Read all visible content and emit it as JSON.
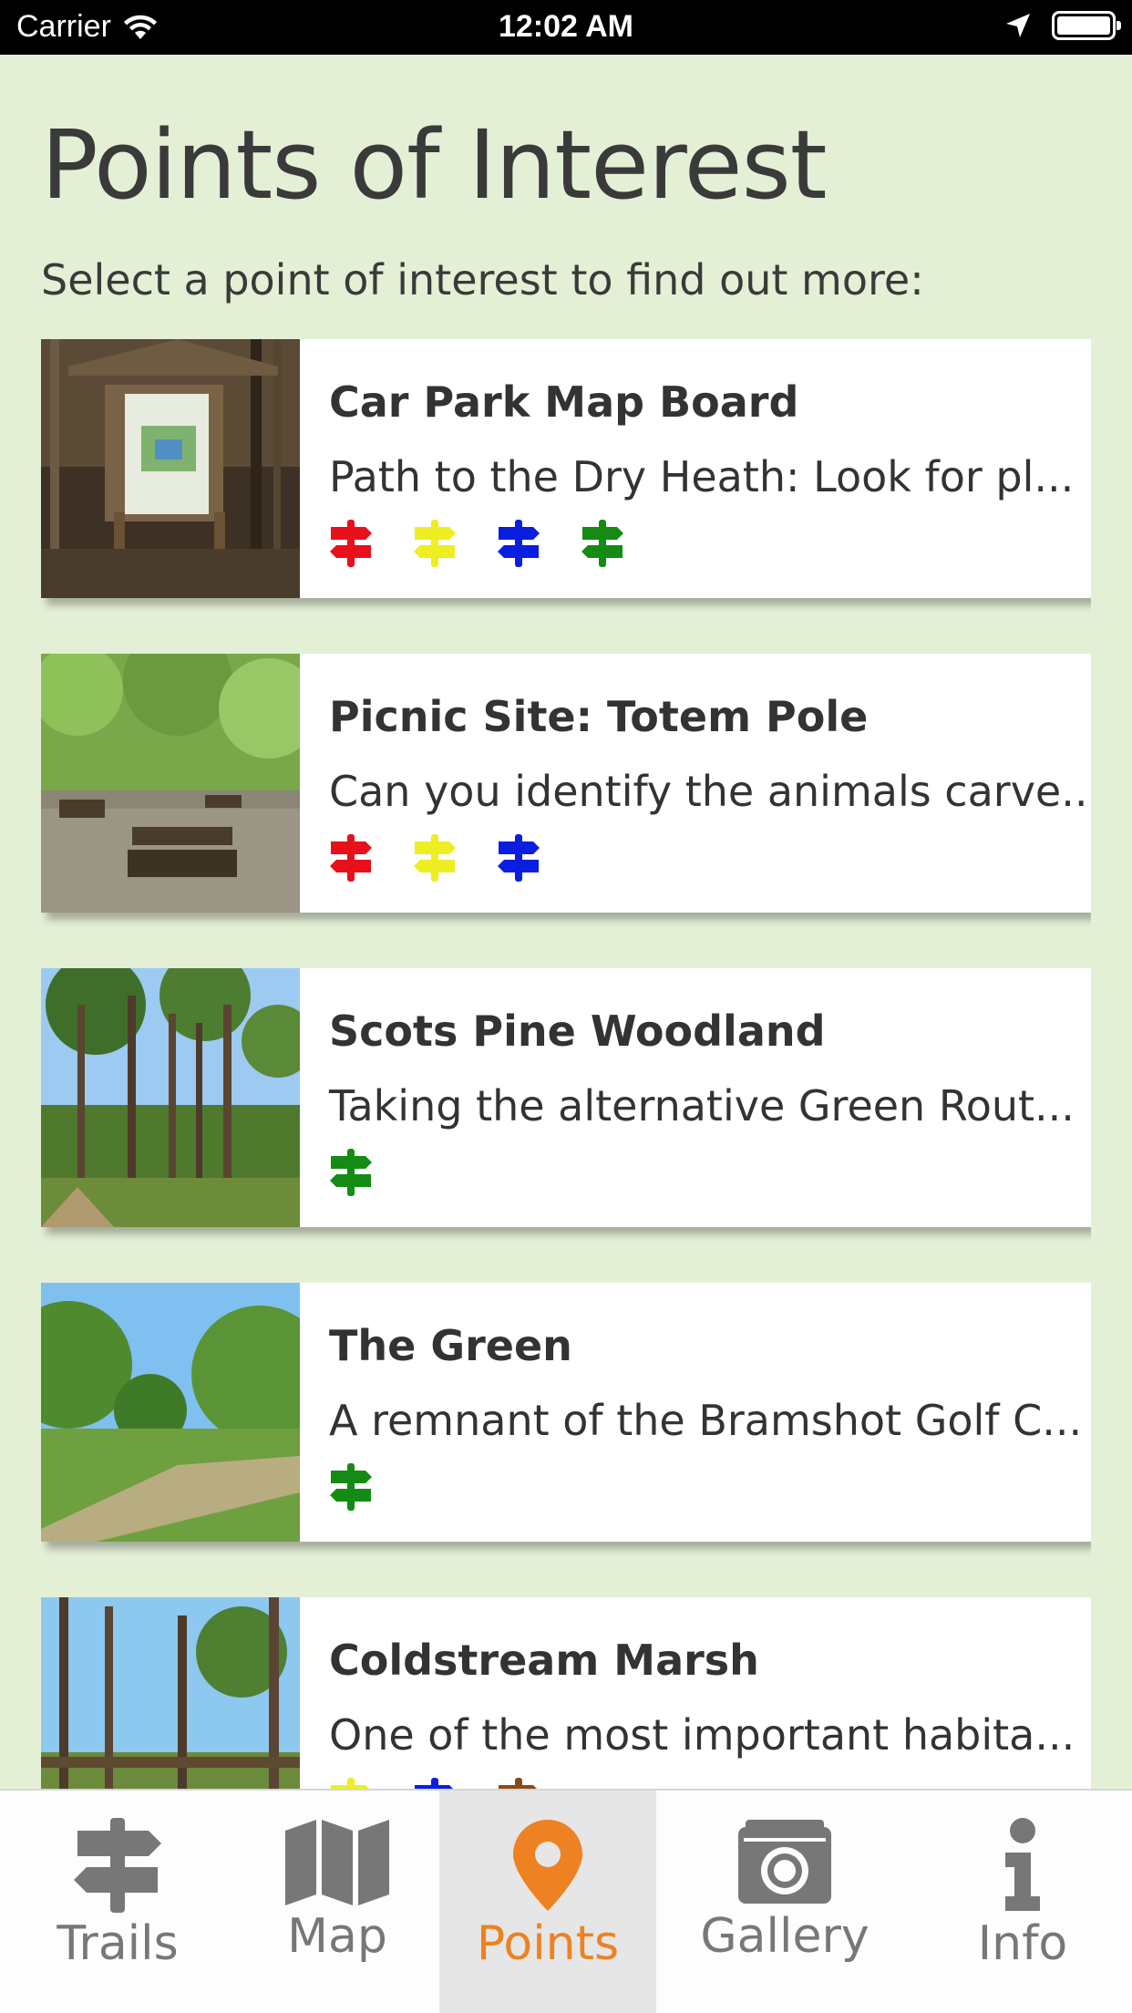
{
  "status_bar": {
    "carrier": "Carrier",
    "time": "12:02 AM"
  },
  "header": {
    "title": "Points of Interest",
    "subtitle": "Select a point of interest to find out more:"
  },
  "points": [
    {
      "title": "Car Park Map Board",
      "description": "Path to the Dry Heath: Look for pl...",
      "trail_colors": [
        "#e8101a",
        "#eeee22",
        "#0a1ee0",
        "#148c14"
      ]
    },
    {
      "title": "Picnic Site: Totem Pole",
      "description": "Can you identify the animals carve...",
      "trail_colors": [
        "#e8101a",
        "#eeee22",
        "#0a1ee0"
      ]
    },
    {
      "title": "Scots Pine Woodland",
      "description": "Taking the alternative Green Rout...",
      "trail_colors": [
        "#148c14"
      ]
    },
    {
      "title": "The Green",
      "description": "A remnant of the Bramshot Golf C...",
      "trail_colors": [
        "#148c14"
      ]
    },
    {
      "title": "Coldstream Marsh",
      "description": "One of the most important habita...",
      "trail_colors": [
        "#eeee22",
        "#0a1ee0",
        "#8b4a1c"
      ]
    }
  ],
  "tabbar": {
    "tabs": [
      {
        "label": "Trails",
        "icon": "signpost-icon",
        "active": false
      },
      {
        "label": "Map",
        "icon": "map-icon",
        "active": false
      },
      {
        "label": "Points",
        "icon": "map-pin-icon",
        "active": true
      },
      {
        "label": "Gallery",
        "icon": "camera-icon",
        "active": false
      },
      {
        "label": "Info",
        "icon": "info-icon",
        "active": false
      }
    ],
    "active_color": "#ee8222",
    "inactive_color": "#777777"
  }
}
